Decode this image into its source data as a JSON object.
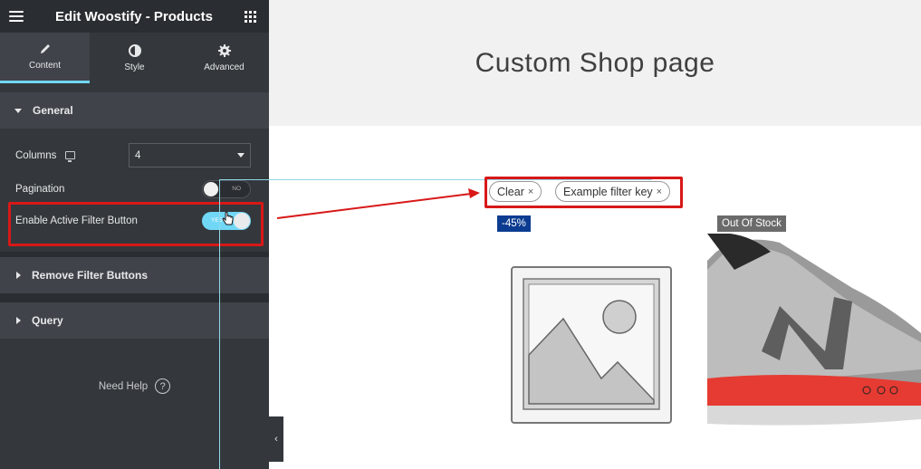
{
  "sidebar": {
    "title": "Edit Woostify - Products",
    "tabs": [
      {
        "label": "Content",
        "icon": "pencil-icon",
        "active": true
      },
      {
        "label": "Style",
        "icon": "half-circle-icon",
        "active": false
      },
      {
        "label": "Advanced",
        "icon": "gear-icon",
        "active": false
      }
    ],
    "sections": {
      "general": "General",
      "remove_filter": "Remove Filter Buttons",
      "query": "Query"
    },
    "controls": {
      "columns_label": "Columns",
      "columns_value": "4",
      "pagination_label": "Pagination",
      "pagination_state": "NO",
      "active_filter_label": "Enable Active Filter Button",
      "active_filter_state": "YES"
    },
    "need_help": "Need Help",
    "help_icon_text": "?",
    "collapse_icon": "‹"
  },
  "preview": {
    "page_title": "Custom Shop page",
    "filters": [
      {
        "label": "Clear"
      },
      {
        "label": "Example filter key"
      }
    ],
    "filter_remove_glyph": "×",
    "products": [
      {
        "badge": "-45%",
        "image": "placeholder-image-icon"
      },
      {
        "badge": "Out Of Stock",
        "image": "sneaker-image"
      }
    ]
  },
  "colors": {
    "accent": "#71d7f7",
    "highlight": "#d81818",
    "sale_badge": "#0c3c91",
    "oos_badge": "#6b6b6b",
    "sidebar_bg": "#34383c"
  }
}
